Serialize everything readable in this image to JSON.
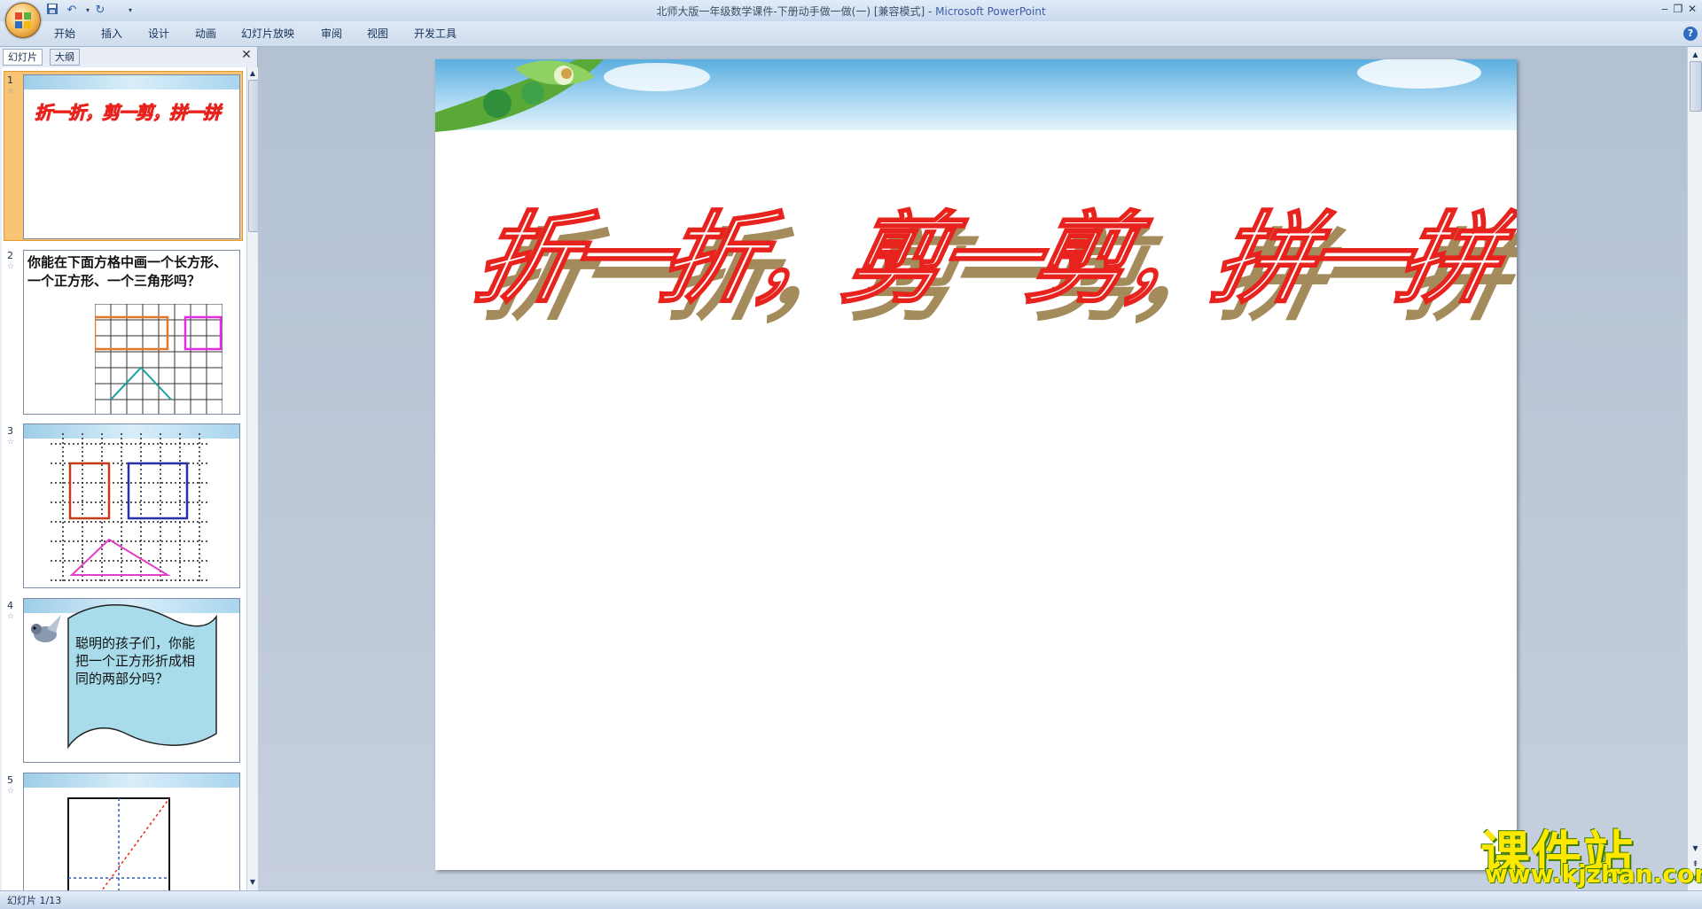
{
  "window": {
    "title": "北师大版一年级数学课件-下册动手做一做(一) [兼容模式]",
    "title_sep": " - ",
    "app_name": "Microsoft PowerPoint",
    "controls": [
      "‒",
      "❐",
      "✕"
    ]
  },
  "quick_access": [
    "save-icon",
    "undo-icon",
    "redo-icon",
    "customize-icon"
  ],
  "ribbon": {
    "tabs": [
      "开始",
      "插入",
      "设计",
      "动画",
      "幻灯片放映",
      "审阅",
      "视图",
      "开发工具"
    ]
  },
  "left_pane": {
    "tabs": [
      "幻灯片",
      "大纲"
    ],
    "close": "✕",
    "thumbnails": [
      {
        "num": "1",
        "text": "折一折，剪一剪，拼一拼"
      },
      {
        "num": "2",
        "text": "你能在下面方格中画一个长方形、一个正方形、一个三角形吗？"
      },
      {
        "num": "3",
        "text": ""
      },
      {
        "num": "4",
        "text": "聪明的孩子们，你能把一个正方形折成相同的两部分吗？"
      },
      {
        "num": "5",
        "text": ""
      }
    ]
  },
  "slide": {
    "title": "折一折，剪一剪，拼一拼"
  },
  "status": {
    "text": "幻灯片 1/13"
  },
  "watermark": {
    "title": "课件站",
    "url": "www.kjzhan.com"
  },
  "colors": {
    "title_outline": "#e8231d",
    "title_shadow": "#a38b5b",
    "sky": "#5aaedf"
  }
}
